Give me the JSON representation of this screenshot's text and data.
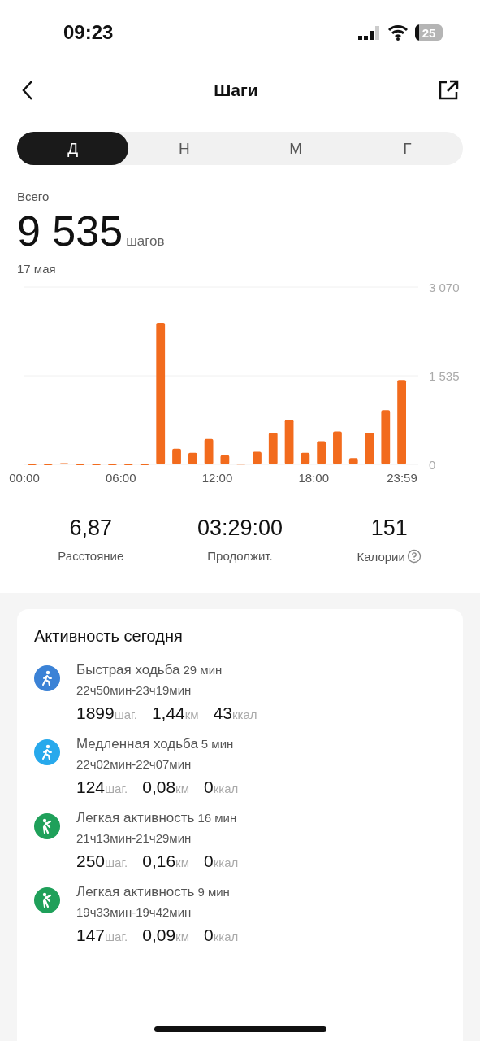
{
  "status_bar": {
    "time": "09:23",
    "battery": "25"
  },
  "header": {
    "title": "Шаги"
  },
  "tabs": [
    {
      "label": "Д",
      "selected": true
    },
    {
      "label": "Н",
      "selected": false
    },
    {
      "label": "М",
      "selected": false
    },
    {
      "label": "Г",
      "selected": false
    }
  ],
  "total": {
    "label": "Всего",
    "value": "9 535",
    "unit": "шагов",
    "date": "17 мая"
  },
  "chart_data": {
    "type": "bar",
    "x": [
      0.5,
      1.5,
      2.5,
      3.5,
      4.5,
      5.5,
      6.5,
      7.5,
      8.5,
      9.5,
      10.5,
      11.5,
      12.5,
      13.5,
      14.5,
      15.5,
      16.5,
      17.5,
      18.5,
      19.5,
      20.5,
      21.5,
      22.5,
      23.5
    ],
    "xlim": [
      0,
      24
    ],
    "series": [
      {
        "color": "#f26b1d",
        "values": [
          0,
          0,
          20,
          0,
          0,
          0,
          0,
          0,
          2450,
          270,
          200,
          440,
          160,
          10,
          220,
          550,
          770,
          200,
          400,
          570,
          110,
          550,
          940,
          1460
        ]
      }
    ],
    "ylim": [
      0,
      3070
    ],
    "yticks": [
      {
        "value": 0,
        "label": "0"
      },
      {
        "value": 1535,
        "label": "1 535"
      },
      {
        "value": 3070,
        "label": "3 070"
      }
    ],
    "xticks": [
      {
        "value": 0,
        "label": "00:00"
      },
      {
        "value": 6,
        "label": "06:00"
      },
      {
        "value": 12,
        "label": "12:00"
      },
      {
        "value": 18,
        "label": "18:00"
      },
      {
        "value": 23.98,
        "label": "23:59"
      }
    ]
  },
  "stats": [
    {
      "value": "6,87",
      "label": "Расстояние",
      "help": false
    },
    {
      "value": "03:29:00",
      "label": "Продолжит.",
      "help": false
    },
    {
      "value": "151",
      "label": "Калории",
      "help": true
    }
  ],
  "activity": {
    "title": "Активность сегодня",
    "items": [
      {
        "kind": "fast",
        "name": "Быстрая ходьба",
        "duration": "29 мин",
        "time": "22ч50мин-23ч19мин",
        "steps": "1899",
        "steps_unit": "шаг.",
        "distance": "1,44",
        "distance_unit": "км",
        "calories": "43",
        "calories_unit": "ккал"
      },
      {
        "kind": "slow",
        "name": "Медленная ходьба",
        "duration": "5 мин",
        "time": "22ч02мин-22ч07мин",
        "steps": "124",
        "steps_unit": "шаг.",
        "distance": "0,08",
        "distance_unit": "км",
        "calories": "0",
        "calories_unit": "ккал"
      },
      {
        "kind": "light",
        "name": "Легкая активность",
        "duration": "16 мин",
        "time": "21ч13мин-21ч29мин",
        "steps": "250",
        "steps_unit": "шаг.",
        "distance": "0,16",
        "distance_unit": "км",
        "calories": "0",
        "calories_unit": "ккал"
      },
      {
        "kind": "light",
        "name": "Легкая активность",
        "duration": "9 мин",
        "time": "19ч33мин-19ч42мин",
        "steps": "147",
        "steps_unit": "шаг.",
        "distance": "0,09",
        "distance_unit": "км",
        "calories": "0",
        "calories_unit": "ккал"
      }
    ]
  }
}
